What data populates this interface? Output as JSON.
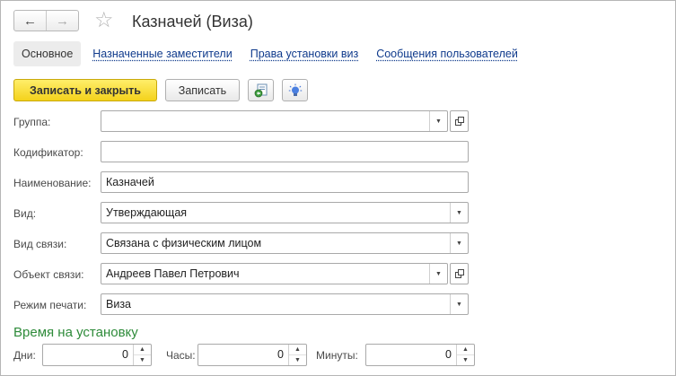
{
  "header": {
    "back_icon": "←",
    "forward_icon": "→",
    "favorite_icon": "☆",
    "title": "Казначей (Виза)"
  },
  "tabs": [
    {
      "label": "Основное",
      "active": true
    },
    {
      "label": "Назначенные заместители",
      "active": false
    },
    {
      "label": "Права установки виз",
      "active": false
    },
    {
      "label": "Сообщения пользователей",
      "active": false
    }
  ],
  "toolbar": {
    "save_close_label": "Записать и закрыть",
    "save_label": "Записать",
    "icon1": "report-structure-icon",
    "icon2": "lightbulb-icon"
  },
  "form": {
    "group": {
      "label": "Группа:",
      "value": ""
    },
    "code": {
      "label": "Кодификатор:",
      "value": ""
    },
    "name": {
      "label": "Наименование:",
      "value": "Казначей"
    },
    "kind": {
      "label": "Вид:",
      "value": "Утверждающая"
    },
    "link_kind": {
      "label": "Вид связи:",
      "value": "Связана с физическим лицом"
    },
    "link_object": {
      "label": "Объект связи:",
      "value": "Андреев Павел Петрович"
    },
    "print_mode": {
      "label": "Режим печати:",
      "value": "Виза"
    }
  },
  "time": {
    "section_title": "Время на установку",
    "days": {
      "label": "Дни:",
      "value": "0"
    },
    "hours": {
      "label": "Часы:",
      "value": "0"
    },
    "minutes": {
      "label": "Минуты:",
      "value": "0"
    }
  },
  "colors": {
    "primary_button": "#f4d21b",
    "link": "#0f3a8c",
    "section_title": "#2e8b3a"
  }
}
